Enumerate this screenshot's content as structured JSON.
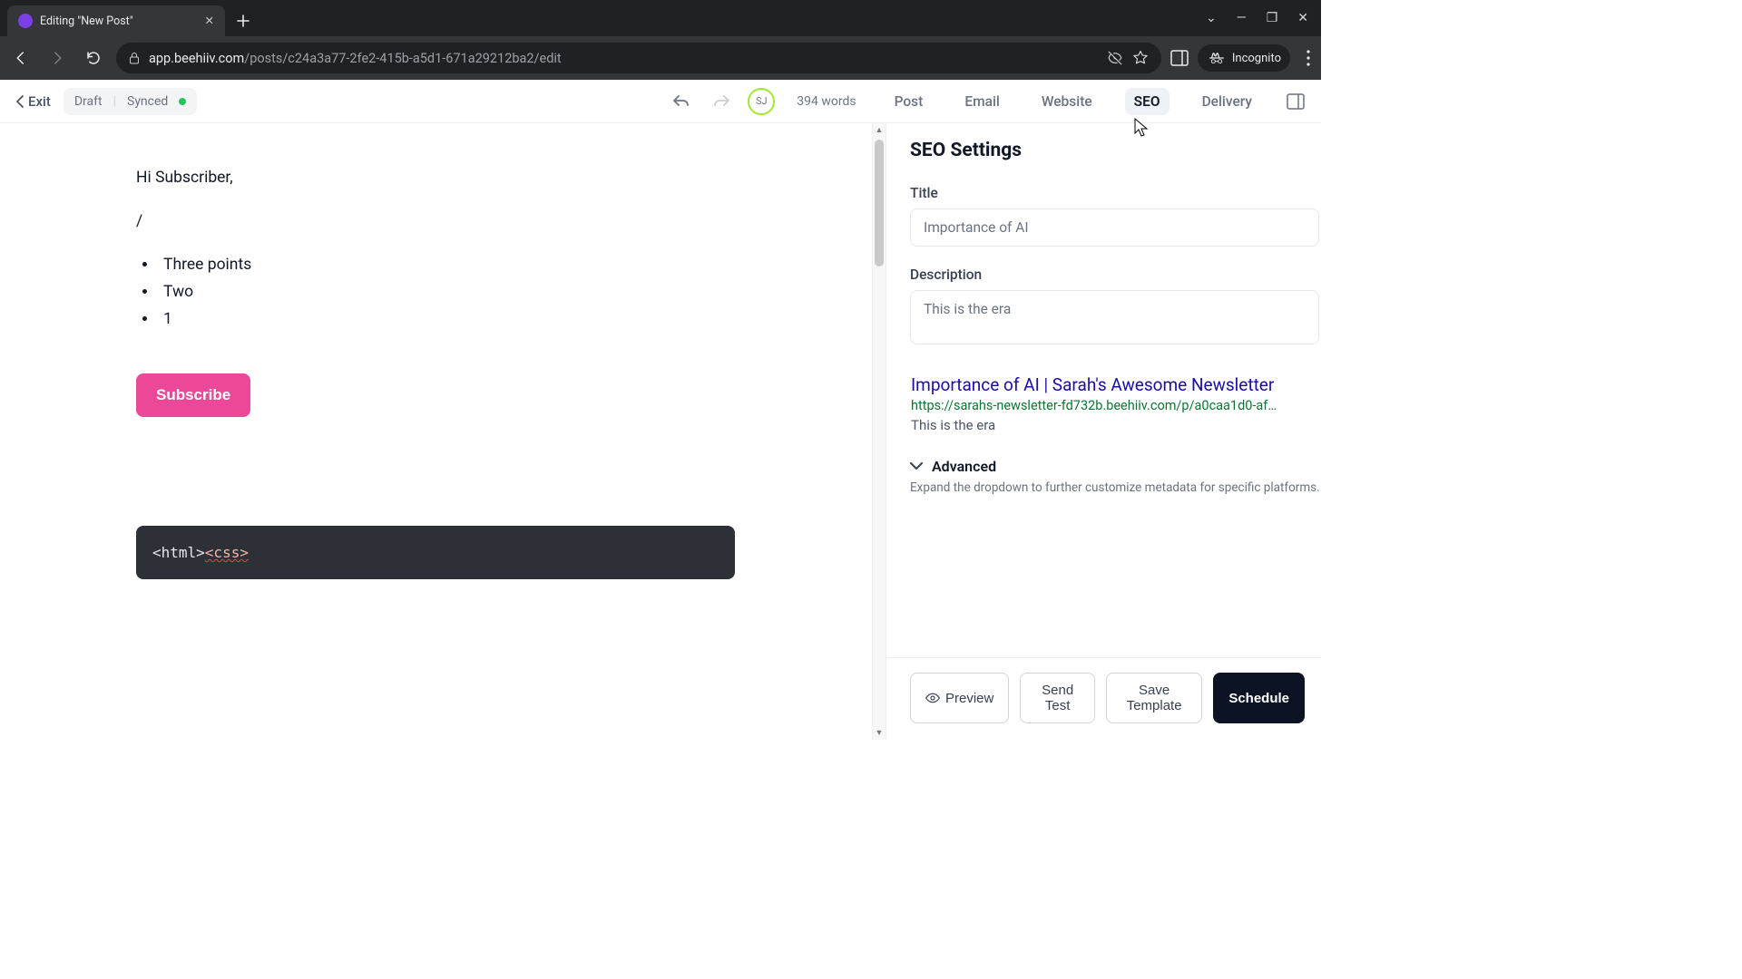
{
  "browser": {
    "tab_title": "Editing \"New Post\"",
    "url_domain": "app.beehiiv.com",
    "url_path": "/posts/c24a3a77-2fe2-415b-a5d1-671a29212ba2/edit",
    "incognito_label": "Incognito"
  },
  "header": {
    "exit_label": "Exit",
    "status_draft": "Draft",
    "status_sync": "Synced",
    "avatar_initials": "SJ",
    "word_count": "394 words",
    "tabs": [
      "Post",
      "Email",
      "Website",
      "SEO",
      "Delivery"
    ],
    "active_tab": "SEO"
  },
  "editor": {
    "greeting": "Hi Subscriber,",
    "slash": "/",
    "bullets": [
      "Three points",
      "Two",
      "1"
    ],
    "subscribe_label": "Subscribe",
    "code_html": "<html>",
    "code_css": "<css>"
  },
  "seo": {
    "heading": "SEO Settings",
    "title_label": "Title",
    "title_value": "Importance of AI",
    "desc_label": "Description",
    "desc_value": "This is the era",
    "preview_title": "Importance of AI | Sarah's Awesome Newsletter",
    "preview_url": "https://sarahs-newsletter-fd732b.beehiiv.com/p/a0caa1d0-af…",
    "preview_desc": "This is the era",
    "advanced_label": "Advanced",
    "advanced_desc": "Expand the dropdown to further customize metadata for specific platforms."
  },
  "footer": {
    "preview": "Preview",
    "send_test": "Send Test",
    "save_template": "Save Template",
    "schedule": "Schedule"
  }
}
